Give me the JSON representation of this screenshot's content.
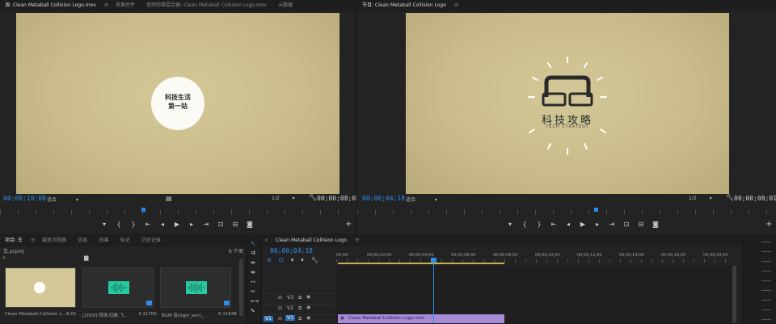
{
  "source_monitor": {
    "tabs": [
      {
        "label": "源: Clean Metaball Collision Logo.mov",
        "active": true
      },
      {
        "label": "效果控件",
        "active": false
      },
      {
        "label": "音频剪辑混合器: Clean Metaball Collision Logo.mov",
        "active": false
      },
      {
        "label": "元数据",
        "active": false
      }
    ],
    "circle_line1": "科技生活",
    "circle_line2": "第一站",
    "timecode_current": "00;00;10;08",
    "fit": "适合",
    "quality": "1/2",
    "timecode_duration": "00;00;08;01"
  },
  "program_monitor": {
    "tab_label": "节目: Clean Metaball Collision Logo",
    "logo_text": "科技攻略",
    "logo_subtext": "TECH STRATEGY",
    "timecode_current": "00;00;04;18",
    "fit": "适合",
    "quality": "1/2",
    "timecode_duration": "00;00;08;01"
  },
  "transport_icons": [
    "marker-icon",
    "in-point-icon",
    "out-point-icon",
    "go-to-in-icon",
    "step-back-icon",
    "play-icon",
    "step-forward-icon",
    "go-to-out-icon",
    "insert-icon",
    "export-frame-icon",
    "add-icon"
  ],
  "project_panel": {
    "tabs": [
      {
        "label": "项目: 车",
        "active": true
      },
      {
        "label": "媒体浏览器",
        "active": false
      },
      {
        "label": "信息",
        "active": false
      },
      {
        "label": "效果",
        "active": false
      },
      {
        "label": "标记",
        "active": false
      },
      {
        "label": "历史记录",
        "active": false
      }
    ],
    "file": "车.prproj",
    "item_count": "6 个项",
    "items": [
      {
        "name": "Clean Metaball Collision L...",
        "duration": "8;01"
      },
      {
        "name": "[2000] 转场,切换,飞...",
        "duration": "3:11700"
      },
      {
        "name": "BGM 音(bgm_wm)_...",
        "duration": "5:11648"
      }
    ]
  },
  "timeline": {
    "tab_label": "Clean Metaball Collision Logo",
    "timecode": "00;00;04;18",
    "ruler_labels": [
      "00;00",
      "00;00;02;00",
      "00;00;04;00",
      "00;00;06;00",
      "00;00;08;00",
      "00;00;10;00",
      "00;00;12;00",
      "00;00;14;00",
      "00;00;16;00",
      "00;00;18;00"
    ],
    "tracks": [
      "V3",
      "V2",
      "V1"
    ],
    "source_patch": "V1",
    "clip_label": "Clean Metaball Collision Logo.mov"
  },
  "colors": {
    "accent_blue": "#2d8ceb",
    "frame_beige": "#c9bc8a",
    "clip_purple": "#a78bd6",
    "audio_green": "#27c9a0"
  }
}
